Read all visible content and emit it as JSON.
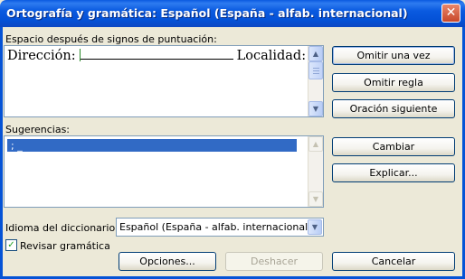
{
  "window": {
    "title": "Ortografía y gramática: Español (España - alfab. internacional)",
    "close_glyph": "✕"
  },
  "error_section": {
    "label": "Espacio después de signos de puntuación:",
    "text_part1": "Dirección:",
    "text_part2": "Localidad:"
  },
  "suggestions": {
    "label": "Sugerencias:",
    "items": [
      "; _"
    ]
  },
  "buttons": {
    "ignore_once": "Omitir una vez",
    "ignore_rule": "Omitir regla",
    "next_sentence": "Oración siguiente",
    "change": "Cambiar",
    "explain": "Explicar...",
    "options": "Opciones...",
    "undo": "Deshacer",
    "cancel": "Cancelar"
  },
  "dictionary": {
    "label": "Idioma del diccionario:",
    "value": "Español (España - alfab. internacional)"
  },
  "grammar_check": {
    "label": "Revisar gramática",
    "checked": true,
    "check_glyph": "✓"
  },
  "icons": {
    "up_arrow": "▲",
    "down_arrow": "▼"
  },
  "colors": {
    "titlebar": "#0a5ae0",
    "dialog_bg": "#ece9d8",
    "selection": "#316ac5",
    "close_button": "#c8472a"
  }
}
